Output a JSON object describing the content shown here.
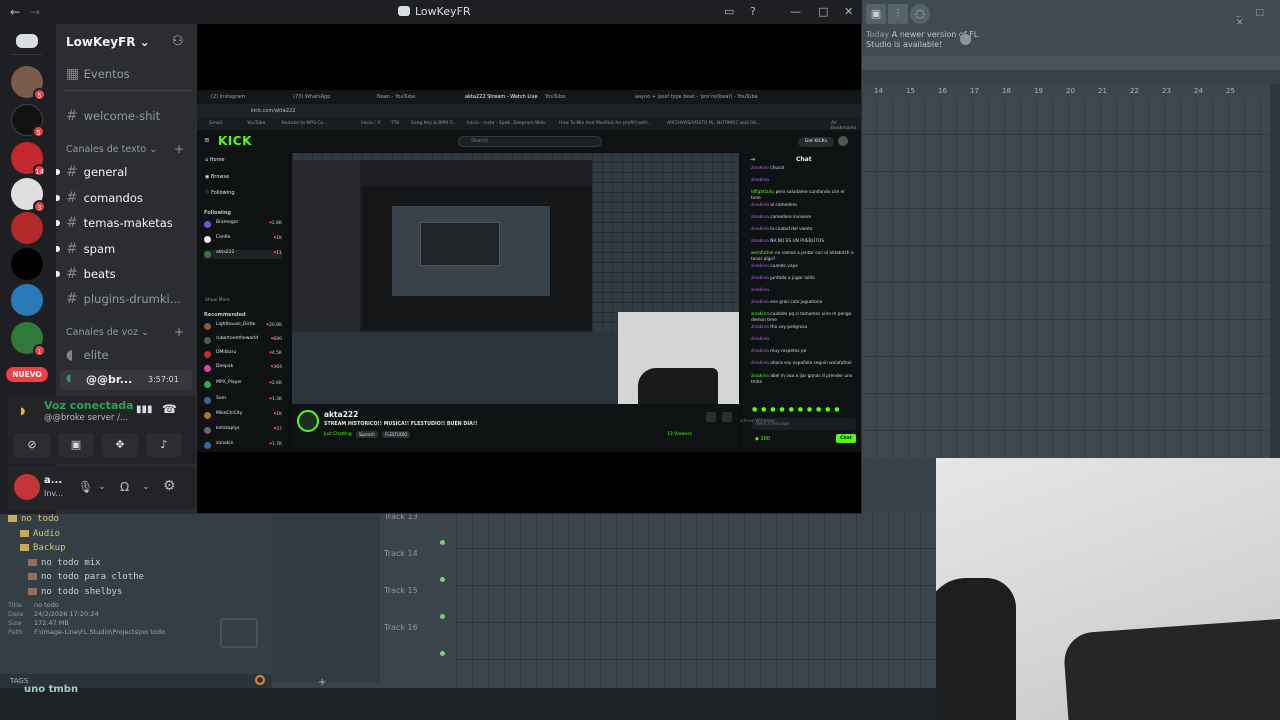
{
  "fl_studio": {
    "news_today": "Today",
    "news_text": "A newer version of FL Studio is available!",
    "ruler_marks": [
      "14",
      "15",
      "16",
      "17",
      "18",
      "19",
      "20",
      "21",
      "22",
      "23",
      "24",
      "25"
    ],
    "browser": {
      "folder_root": "no todo",
      "folders": [
        "Audio",
        "Backup"
      ],
      "files": [
        "no todo mix",
        "no todo para clothe",
        "no todo shelbys"
      ],
      "info": {
        "title_label": "Title",
        "title": "no todo",
        "date_label": "Date",
        "date": "24/2/2026 17:20:24",
        "size_label": "Size",
        "size": "172.47 MB",
        "path_label": "Path",
        "path": "F:\\Image-Line\\FL Studio\\Projects\\no todo"
      },
      "tags_label": "TAGS"
    },
    "tracks": [
      "Track 13",
      "Track 14",
      "Track 15",
      "Track 16"
    ],
    "bottom_text": "uno tmbn"
  },
  "discord": {
    "window_title": "LowKeyFR",
    "server_name": "LowKeyFR",
    "server_badges": [
      "5",
      "5",
      "",
      "14",
      "3",
      "",
      "",
      "",
      "1"
    ],
    "new_label": "NUEVO",
    "events_label": "Eventos",
    "welcome_channel": "welcome-shit",
    "text_category": "Canales de texto",
    "text_channels": [
      "general",
      "comandos",
      "temas-maketas",
      "spam",
      "beats",
      "plugins-drumki..."
    ],
    "voice_category": "Canales de voz",
    "voice_channels": [
      "elite"
    ],
    "active_voice": {
      "name": "@@br...",
      "time": "3:57:01"
    },
    "voice_panel": {
      "status": "Voz conectada",
      "sub": "@@broke server /..."
    },
    "user": {
      "name": "a...",
      "status": "Inv..."
    }
  },
  "kick": {
    "tabs": [
      "(2) Instagram",
      "(73) WhatsApp",
      "Naan - YouTube",
      "akta222 Stream - Watch Live",
      "YouTube",
      "aayoo + jassf type beat - 'pro'",
      "no(beat) - YouTube"
    ],
    "url": "kick.com/akta222",
    "bookmarks": [
      "Gmail",
      "YouTube",
      "Youtube to MP3 Co...",
      "Inicio / X",
      "TTK",
      "Song Key & BPM Fi...",
      "Inicio - Insta - Spoti...",
      "Telegram Web",
      "How To Mix And Mas...",
      "Pick for profit] with...",
      "ARCHIVOS/VOSTO M...",
      "NOTIMO7 wild 04...",
      "All Bookmarks"
    ],
    "logo": "KICK",
    "search_placeholder": "Search",
    "get_kicks": "Get KICKs",
    "nav": [
      "Home",
      "Browse",
      "Following"
    ],
    "following_label": "Following",
    "following": [
      {
        "name": "Bramegor",
        "viewers": "2.8K"
      },
      {
        "name": "Cenfle",
        "viewers": "1K"
      },
      {
        "name": "akta222",
        "viewers": "11"
      }
    ],
    "show_more": "Show More",
    "recommended_label": "Recommended",
    "recommended": [
      {
        "name": "Lighthouse_Dirtle",
        "viewers": "20.8K"
      },
      {
        "name": "rubertonetheworld",
        "viewers": "690"
      },
      {
        "name": "DMitkaru",
        "viewers": "4.5K"
      },
      {
        "name": "Deepak",
        "viewers": "364"
      },
      {
        "name": "MPX_Player",
        "viewers": "2.6K"
      },
      {
        "name": "Sam",
        "viewers": "1.3K"
      },
      {
        "name": "MikeChiCity",
        "viewers": "1K"
      },
      {
        "name": "ketskoplys",
        "viewers": "57"
      },
      {
        "name": "zonakin",
        "viewers": "1.7K"
      }
    ],
    "chat_title": "Chat",
    "chat_messages": [
      {
        "user": "zinakina",
        "text": "chucol"
      },
      {
        "user": "zinakina",
        "text": ""
      },
      {
        "user": "ldfightlaitu",
        "text": "pero saludame cundando con el tune"
      },
      {
        "user": "zinakina",
        "text": "al comedero"
      },
      {
        "user": "zinakina",
        "text": "comedore invisiere"
      },
      {
        "user": "zinakina",
        "text": "la ciudad del viento"
      },
      {
        "user": "zinakina",
        "text": "NA NO ES UN PUEBLITOS"
      },
      {
        "user": "welafuthal",
        "text": "no vamos a jentar con el aktabitch a tonar algo?"
      },
      {
        "user": "zinakina",
        "text": "cuando vaya"
      },
      {
        "user": "zinakina",
        "text": "juntada a jugar lolito"
      },
      {
        "user": "zinakina",
        "text": ""
      },
      {
        "user": "zinakina",
        "text": "esa gran cola juguetona"
      },
      {
        "user": "zinakina",
        "text": "cuidado pq si tomamos vino m pongo demon time"
      },
      {
        "user": "zinakina",
        "text": "tho soy peligrosa"
      },
      {
        "user": "zinakina",
        "text": ""
      },
      {
        "user": "zinakina",
        "text": "muy respetos pe"
      },
      {
        "user": "zinakina",
        "text": "ahora soy española seguin wolafuthal"
      },
      {
        "user": "zinakina",
        "text": "abel m voa a ijar ganas d prender uno tmbn"
      }
    ],
    "chat_placeholder": "Send a message",
    "chat_send": "Chat",
    "points": "100",
    "activate_text": "Activar Windows",
    "streamer": "akta222",
    "stream_title": "STREAM HISTORICO!! MUSICA!! FLESTUDIO!! BUEN DIA!!",
    "category": "Just Chatting",
    "tags": [
      "Spanish",
      "FLESTUDIO"
    ],
    "viewers": "13 Viewers"
  }
}
